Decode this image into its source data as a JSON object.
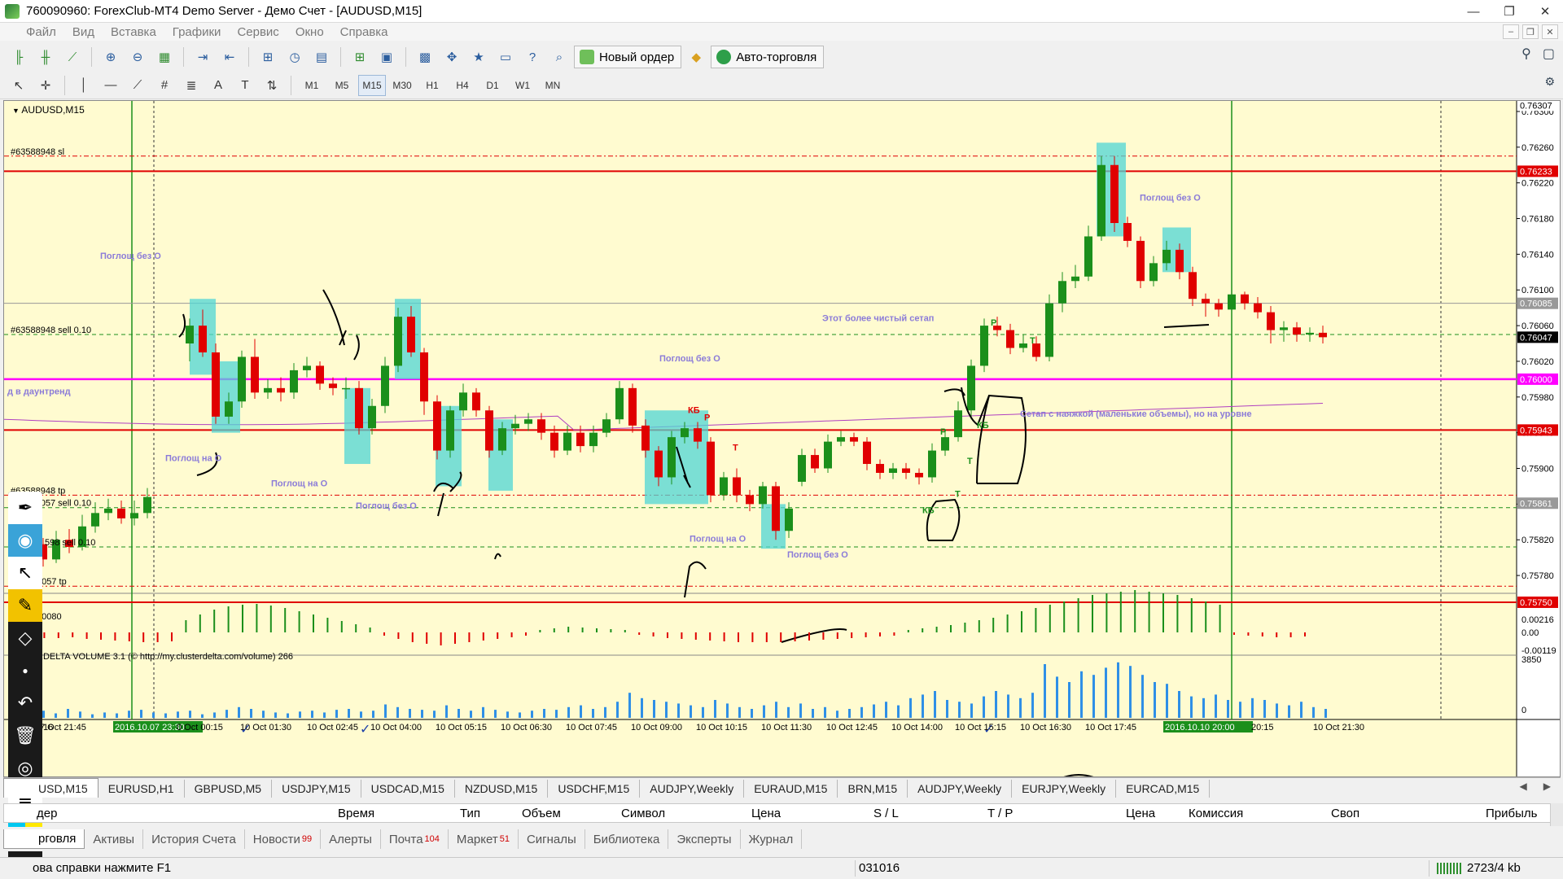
{
  "window": {
    "title": "760090960: ForexClub-MT4 Demo Server - Демо Счет - [AUDUSD,M15]"
  },
  "menu": [
    "Файл",
    "Вид",
    "Вставка",
    "Графики",
    "Сервис",
    "Окно",
    "Справка"
  ],
  "toolbar": {
    "new_order": "Новый ордер",
    "autotrading": "Авто-торговля"
  },
  "timeframes": [
    "M1",
    "M5",
    "M15",
    "M30",
    "H1",
    "H4",
    "D1",
    "W1",
    "MN"
  ],
  "active_timeframe": "M15",
  "chart": {
    "title": "AUDUSD,M15",
    "price_axis": [
      "0.76300",
      "0.76260",
      "0.76220",
      "0.76180",
      "0.76140",
      "0.76100",
      "0.76060",
      "0.76020",
      "0.75980",
      "0.75940",
      "0.75900",
      "0.75860",
      "0.75820",
      "0.75780"
    ],
    "price_tags": {
      "top": "0.76307",
      "red_top": "0.76233",
      "grey": "0.76085",
      "bid": "0.76047",
      "magenta": "0.76000",
      "red_mid": "0.75943",
      "grey_low": "0.75861",
      "red_low": "0.75750"
    },
    "order_labels": {
      "sl": "#63588948 sl",
      "sell": "#63588948 sell 0.10",
      "tp": "#63588948 tp",
      "sell2": "#63539057 sell 0.10",
      "sell3": "598 sell 0.10",
      "tp2": "9057 tp"
    },
    "level_label": "д в даунтренд",
    "osc_label": "00080",
    "osc_axis": [
      "0.00216",
      "0.00",
      "-0.00119"
    ],
    "vol_label": "RDELTA VOLUME 3.1 (© http://my.clusterdelta.com/volume) 266",
    "vol_axis": [
      "3850",
      "0"
    ],
    "time_axis": [
      "7 Oct 21:45",
      "2016.10.07 23:30",
      "0 Oct 00:15",
      "10 Oct 01:30",
      "10 Oct 02:45",
      "10 Oct 04:00",
      "10 Oct 05:15",
      "10 Oct 06:30",
      "10 Oct 07:45",
      "10 Oct 09:00",
      "10 Oct 10:15",
      "10 Oct 11:30",
      "10 Oct 12:45",
      "10 Oct 14:00",
      "10 Oct 15:15",
      "10 Oct 16:30",
      "10 Oct 17:45",
      "2016.10.10 20:00",
      "20:15",
      "10 Oct 21:30"
    ],
    "time_axis_left": "16",
    "annotations": {
      "a1": "Поглощ без О",
      "a2": "Поглощ на О",
      "a3": "Поглощ на О",
      "a4": "Поглощ без О",
      "a5": "Поглощ без О",
      "a6": "Поглощ на О",
      "a7": "Поглощ без О",
      "a8": "Этот более чистый сетап",
      "a9": "Сетап с наяжкой (маленькие объемы), но на уровне",
      "a10": "Поглощ без О"
    },
    "marks": {
      "kb1": "КБ",
      "p1": "Р",
      "t1": "Т",
      "p2": "Р",
      "t2": "Т",
      "kb2": "КБ",
      "p3": "Р",
      "kb3": "КБ",
      "t3": "Т",
      "t4": "Т"
    }
  },
  "symbol_tabs": [
    "USD,M15",
    "EURUSD,H1",
    "GBPUSD,M5",
    "USDJPY,M15",
    "USDCAD,M15",
    "NZDUSD,M15",
    "USDCHF,M15",
    "AUDJPY,Weekly",
    "EURAUD,M15",
    "BRN,M15",
    "AUDJPY,Weekly",
    "EURJPY,Weekly",
    "EURCAD,M15"
  ],
  "terminal_columns": [
    "дер",
    "Время",
    "Тип",
    "Объем",
    "Символ",
    "Цена",
    "S / L",
    "T / P",
    "Цена",
    "Комиссия",
    "Своп",
    "Прибыль"
  ],
  "terminal_tabs": [
    {
      "label": "рговля",
      "badge": ""
    },
    {
      "label": "Активы",
      "badge": ""
    },
    {
      "label": "История Счета",
      "badge": ""
    },
    {
      "label": "Новости",
      "badge": "99"
    },
    {
      "label": "Алерты",
      "badge": ""
    },
    {
      "label": "Почта",
      "badge": "104"
    },
    {
      "label": "Маркет",
      "badge": "51"
    },
    {
      "label": "Сигналы",
      "badge": ""
    },
    {
      "label": "Библиотека",
      "badge": ""
    },
    {
      "label": "Эксперты",
      "badge": ""
    },
    {
      "label": "Журнал",
      "badge": ""
    }
  ],
  "status": {
    "help": "ова справки нажмите F1",
    "profile": "031016",
    "traffic": "2723/4 kb"
  },
  "colors": {
    "chart_bg": "#fffbd0",
    "bull": "#1b8f1b",
    "bear": "#e00000",
    "highlight": "#4fd6d6",
    "magenta_line": "#ff00ff",
    "annotation": "#8b7bd8",
    "volume_bar": "#2f8fe6"
  }
}
